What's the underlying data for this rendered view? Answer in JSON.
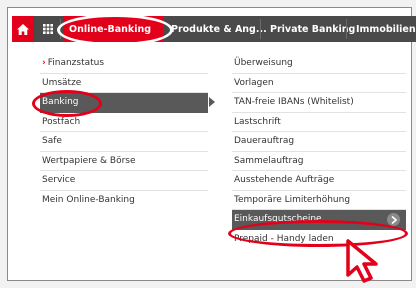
{
  "nav": {
    "tabs": [
      {
        "label": "Online-Banking"
      },
      {
        "label": "Produkte & Ang..."
      },
      {
        "label": "Private Banking"
      },
      {
        "label": "Immobilien"
      }
    ],
    "icons": {
      "home": "home-icon",
      "grid": "grid-menu-icon"
    }
  },
  "menu_left": {
    "items": [
      {
        "label": "Finanzstatus"
      },
      {
        "label": "Umsätze"
      },
      {
        "label": "Banking"
      },
      {
        "label": "Postfach"
      },
      {
        "label": "Safe"
      },
      {
        "label": "Wertpapiere & Börse"
      },
      {
        "label": "Service"
      },
      {
        "label": "Mein Online-Banking"
      }
    ]
  },
  "menu_right": {
    "items": [
      {
        "label": "Überweisung"
      },
      {
        "label": "Vorlagen"
      },
      {
        "label": "TAN-freie IBANs (Whitelist)"
      },
      {
        "label": "Lastschrift"
      },
      {
        "label": "Dauerauftrag"
      },
      {
        "label": "Sammelauftrag"
      },
      {
        "label": "Ausstehende Aufträge"
      },
      {
        "label": "Temporäre Limiterhöhung"
      },
      {
        "label": "Einkaufsgutscheine"
      },
      {
        "label": "Prepaid - Handy laden"
      }
    ]
  },
  "colors": {
    "brand_red": "#e2001a",
    "nav_gray": "#4a4a4a",
    "active_gray": "#595959"
  }
}
